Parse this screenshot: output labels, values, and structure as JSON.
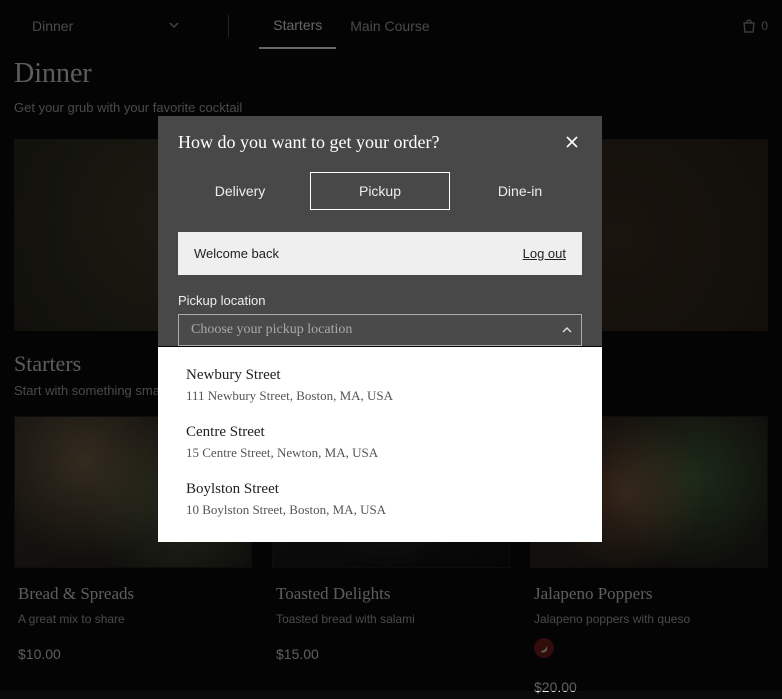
{
  "nav": {
    "dropdown_label": "Dinner",
    "links": [
      {
        "label": "Starters",
        "active": true
      },
      {
        "label": "Main Course",
        "active": false
      }
    ],
    "bag_count": "0"
  },
  "page": {
    "title": "Dinner",
    "subtitle": "Get your grub with your favorite cocktail"
  },
  "starters": {
    "title": "Starters",
    "subtitle": "Start with something small",
    "cards": [
      {
        "name": "Bread & Spreads",
        "desc": "A great mix to share",
        "price": "$10.00",
        "spicy": false
      },
      {
        "name": "Toasted Delights",
        "desc": "Toasted bread with salami",
        "price": "$15.00",
        "spicy": false
      },
      {
        "name": "Jalapeno Poppers",
        "desc": "Jalapeno poppers with queso",
        "price": "$20.00",
        "spicy": true
      }
    ]
  },
  "modal": {
    "title": "How do you want to get your order?",
    "tabs": {
      "delivery": "Delivery",
      "pickup": "Pickup",
      "dinein": "Dine-in"
    },
    "welcome": "Welcome back",
    "logout": "Log out",
    "pickup_label": "Pickup location",
    "placeholder": "Choose your pickup location",
    "locations": [
      {
        "name": "Newbury Street",
        "addr": "111 Newbury Street, Boston, MA, USA"
      },
      {
        "name": "Centre Street",
        "addr": "15 Centre Street, Newton, MA, USA"
      },
      {
        "name": "Boylston Street",
        "addr": "10 Boylston Street, Boston, MA, USA"
      }
    ]
  }
}
